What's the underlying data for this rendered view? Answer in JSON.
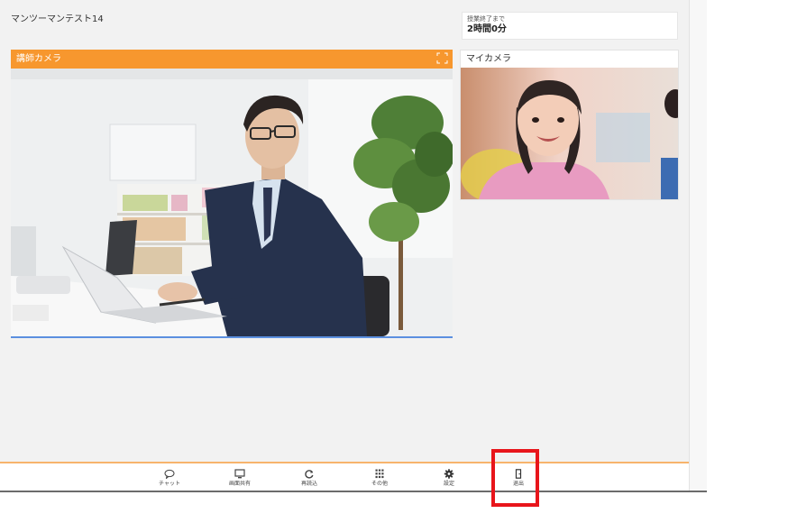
{
  "session": {
    "title": "マンツーマンテスト14"
  },
  "timer": {
    "label": "授業終了まで",
    "value": "2時間0分"
  },
  "teacher_camera": {
    "title": "講師カメラ",
    "expand_icon": "expand-icon"
  },
  "my_camera": {
    "title": "マイカメラ"
  },
  "toolbar": {
    "items": [
      {
        "label": "チャット",
        "icon": "chat-bubble-icon"
      },
      {
        "label": "画面共有",
        "icon": "monitor-icon"
      },
      {
        "label": "再読込",
        "icon": "refresh-icon"
      },
      {
        "label": "その他",
        "icon": "grid-icon"
      },
      {
        "label": "設定",
        "icon": "gear-icon"
      },
      {
        "label": "退出",
        "icon": "exit-door-icon"
      }
    ]
  },
  "colors": {
    "accent": "#f7972e",
    "highlight": "#e8151b",
    "background": "#f2f2f2"
  }
}
